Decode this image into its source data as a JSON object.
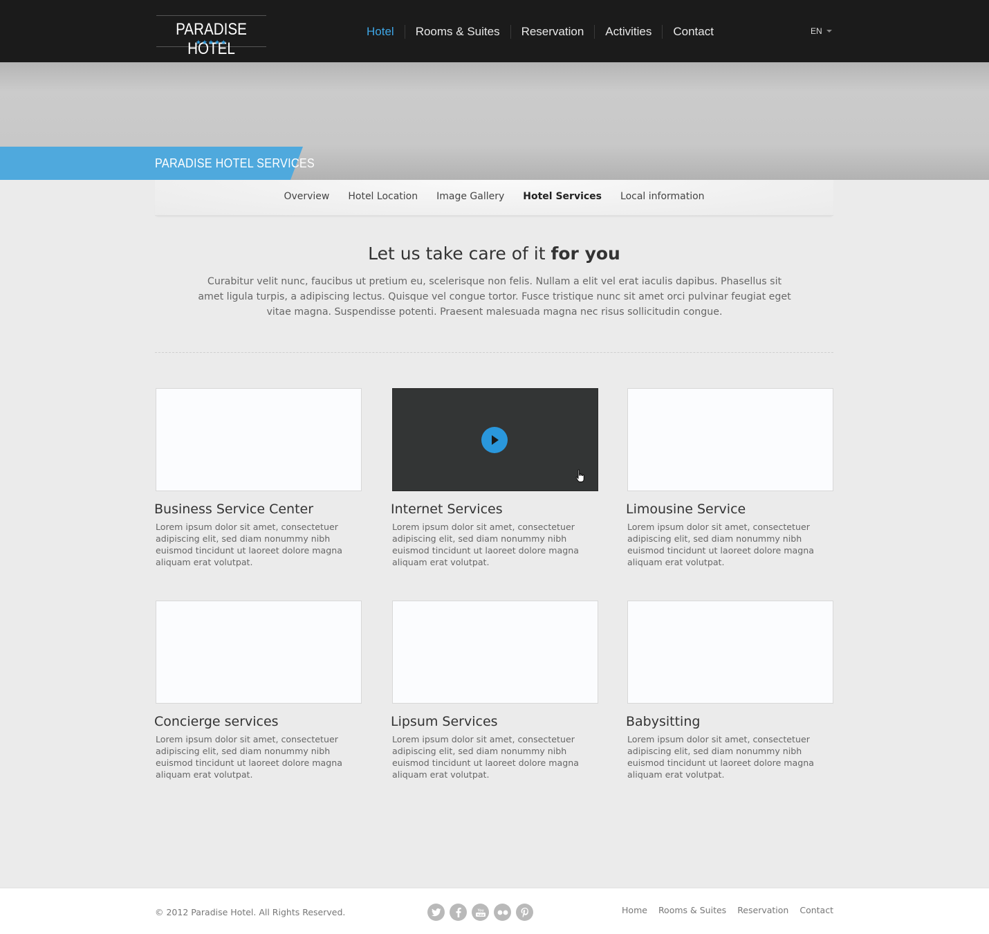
{
  "header": {
    "logo_text": "PARADISE HOTEL",
    "logo_stars": "★★★★★",
    "nav": [
      "Hotel",
      "Rooms & Suites",
      "Reservation",
      "Activities",
      "Contact"
    ],
    "active_nav": "Hotel",
    "language": "EN"
  },
  "hero": {
    "ribbon_title": "PARADISE HOTEL SERVICES"
  },
  "subnav": {
    "items": [
      "Overview",
      "Hotel Location",
      "Image Gallery",
      "Hotel Services",
      "Local information"
    ],
    "active": "Hotel Services"
  },
  "intro": {
    "title_light": "Let us take care of it",
    "title_bold": "for you",
    "text": "Curabitur velit nunc, faucibus ut pretium eu, scelerisque non felis. Nullam a elit vel erat iaculis dapibus. Phasellus sit amet ligula turpis, a adipiscing lectus. Quisque vel congue tortor. Fusce tristique nunc sit amet orci pulvinar feugiat eget vitae magna. Suspendisse potenti. Praesent malesuada magna nec risus sollicitudin congue."
  },
  "services": [
    {
      "title": "Business Service Center",
      "text": "Lorem ipsum dolor sit amet, consectetuer adipiscing elit, sed diam nonummy nibh euismod tincidunt ut laoreet dolore magna aliquam erat volutpat.",
      "media": "image"
    },
    {
      "title": "Internet Services",
      "text": "Lorem ipsum dolor sit amet, consectetuer adipiscing elit, sed diam nonummy nibh euismod tincidunt ut laoreet dolore magna aliquam erat volutpat.",
      "media": "video"
    },
    {
      "title": "Limousine Service",
      "text": "Lorem ipsum dolor sit amet, consectetuer adipiscing elit, sed diam nonummy nibh euismod tincidunt ut laoreet dolore magna aliquam erat volutpat.",
      "media": "image"
    },
    {
      "title": "Concierge services",
      "text": "Lorem ipsum dolor sit amet, consectetuer adipiscing elit, sed diam nonummy nibh euismod tincidunt ut laoreet dolore magna aliquam erat volutpat.",
      "media": "image"
    },
    {
      "title": "Lipsum Services",
      "text": "Lorem ipsum dolor sit amet, consectetuer adipiscing elit, sed diam nonummy nibh euismod tincidunt ut laoreet dolore magna aliquam erat volutpat.",
      "media": "image"
    },
    {
      "title": "Babysitting",
      "text": "Lorem ipsum dolor sit amet, consectetuer adipiscing elit, sed diam nonummy nibh euismod tincidunt ut laoreet dolore magna aliquam erat volutpat.",
      "media": "image"
    }
  ],
  "footer": {
    "copyright": "© 2012 Paradise Hotel. All Rights Reserved.",
    "social": [
      "twitter-icon",
      "facebook-icon",
      "youtube-icon",
      "flickr-icon",
      "pinterest-icon"
    ],
    "nav": [
      "Home",
      "Rooms & Suites",
      "Reservation",
      "Contact"
    ]
  },
  "colors": {
    "accent": "#3ea6e6",
    "ribbon": "#4fa9dd",
    "header_bg": "#1b1b1b",
    "page_bg": "#ebebeb"
  }
}
